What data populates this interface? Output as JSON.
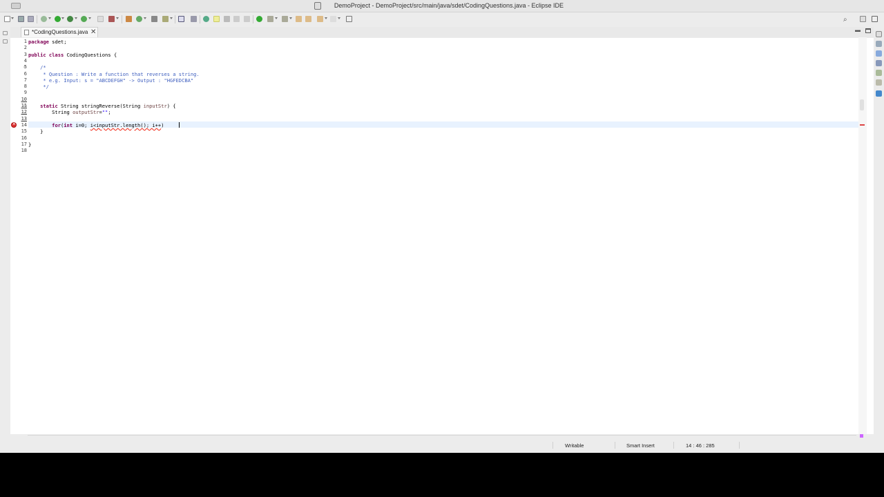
{
  "window": {
    "title": "DemoProject - DemoProject/src/main/java/sdet/CodingQuestions.java - Eclipse IDE"
  },
  "toolbar": {
    "icons": [
      "new-icon",
      "save-icon",
      "save-all-icon",
      "build-icon",
      "debug-icon",
      "run-icon",
      "coverage-icon",
      "external-tools-icon",
      "new-java-project-icon",
      "new-package-icon",
      "new-class-icon",
      "open-type-icon",
      "open-task-icon",
      "search-icon",
      "toggle-mark-occurrences-icon",
      "highlight-icon",
      "block-selection-icon",
      "show-whitespace-icon",
      "next-annotation-icon",
      "prev-annotation-icon",
      "last-edit-icon",
      "back-icon",
      "forward-icon",
      "pin-editor-icon"
    ],
    "search_glyph": "⌕"
  },
  "tabs": {
    "editor_tab_label": "*CodingQuestions.java",
    "close_glyph": "✕"
  },
  "editor": {
    "line_numbers": [
      "1",
      "2",
      "3",
      "4",
      "5",
      "6",
      "7",
      "8",
      "9",
      "10",
      "11",
      "12",
      "13",
      "14",
      "15",
      "16",
      "17",
      "18"
    ],
    "error_line": 14
  },
  "status": {
    "writable": "Writable",
    "insert_mode": "Smart Insert",
    "position": "14 : 46 : 285"
  },
  "colors": {
    "keyword": "#7f0055",
    "comment": "#3f5fbf",
    "string": "#2a00ff",
    "field": "#6a3e3e",
    "error": "#dd2222"
  }
}
